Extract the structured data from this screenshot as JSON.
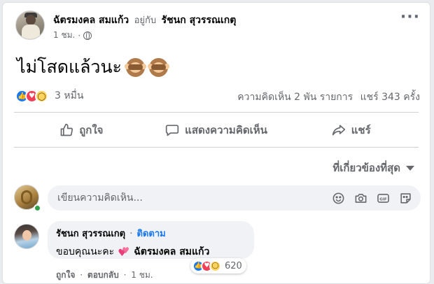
{
  "post": {
    "author": "ฉัตรมงคล สมแก้ว",
    "with_label": "อยู่กับ",
    "tagged": "รัชนก สุวรรณเกตุ",
    "time": "1 ชม.",
    "time_sep": "·",
    "text": "ไม่โสดแล้วนะ",
    "more_icon": "more-dots-icon",
    "privacy_icon": "globe-icon"
  },
  "stats": {
    "reactions_count": "3 หมื่น",
    "comments": "ความคิดเห็น 2 พัน รายการ",
    "shares": "แชร์ 343 ครั้ง",
    "reaction_types": [
      "like",
      "love",
      "wow"
    ]
  },
  "actions": {
    "like": "ถูกใจ",
    "comment": "แสดงความคิดเห็น",
    "share": "แชร์"
  },
  "sort": {
    "label": "ที่เกี่ยวข้องที่สุด"
  },
  "composer": {
    "placeholder": "เขียนความคิดเห็น...",
    "value": "",
    "tools": [
      "emoji-icon",
      "camera-icon",
      "gif-icon",
      "sticker-icon"
    ],
    "gif_label": "GIF"
  },
  "comment": {
    "name": "รัชนก สุวรรณเกตุ",
    "sep": "·",
    "follow": "ติดตาม",
    "text": "ขอบคุณนะคะ",
    "mention": "ฉัตรมงคล สมแก้ว",
    "like": "ถูกใจ",
    "reply": "ตอบกลับ",
    "time": "1 ชม.",
    "dot": "·",
    "reaction_count": "620",
    "reaction_types": [
      "like",
      "love",
      "haha"
    ]
  },
  "colors": {
    "accent": "#1877f2",
    "love": "#f33e58",
    "wow": "#fcd35f",
    "muted": "#65676b",
    "online": "#31a24c"
  }
}
